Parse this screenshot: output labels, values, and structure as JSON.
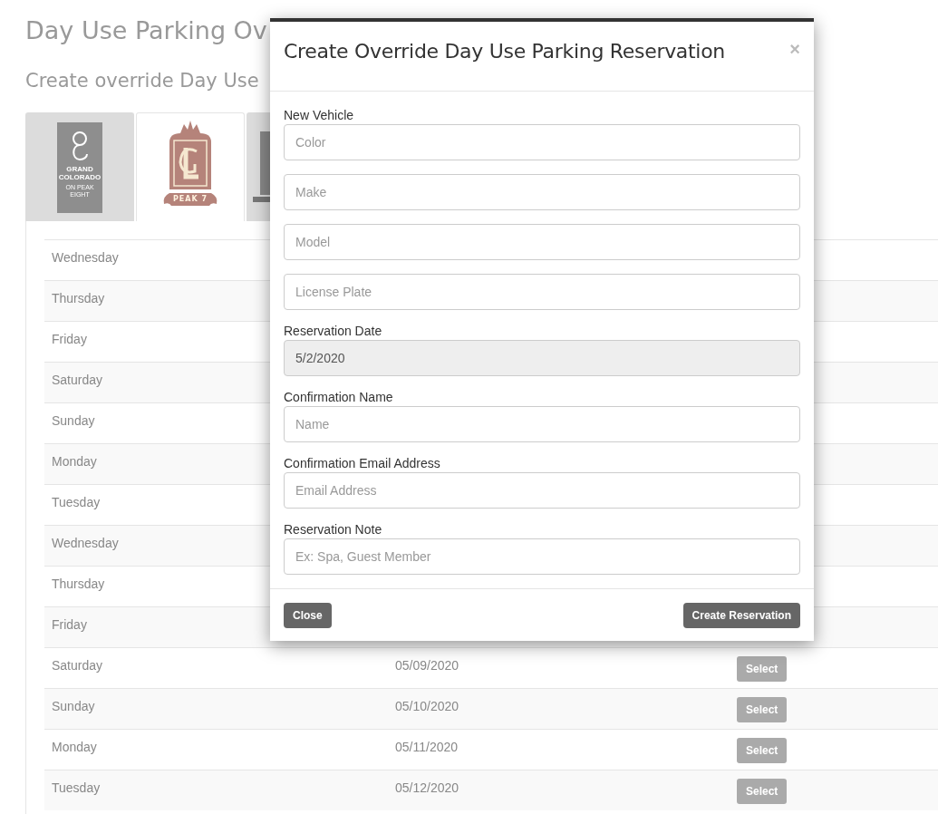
{
  "page": {
    "title": "Day Use Parking Ov",
    "subtitle": "Create override Day Use"
  },
  "property_tabs": [
    {
      "kind": "grand",
      "name": "GRAND COLORADO",
      "tagline": "ON PEAK EIGHT",
      "selected": false
    },
    {
      "kind": "peak",
      "name": "PEAK 7",
      "selected": true
    },
    {
      "kind": "third",
      "selected": false
    }
  ],
  "table": {
    "rows": [
      {
        "day": "Wednesday"
      },
      {
        "day": "Thursday"
      },
      {
        "day": "Friday"
      },
      {
        "day": "Saturday"
      },
      {
        "day": "Sunday"
      },
      {
        "day": "Monday"
      },
      {
        "day": "Tuesday"
      },
      {
        "day": "Wednesday"
      },
      {
        "day": "Thursday"
      },
      {
        "day": "Friday"
      },
      {
        "day": "Saturday",
        "date": "05/09/2020",
        "action": "Select"
      },
      {
        "day": "Sunday",
        "date": "05/10/2020",
        "action": "Select"
      },
      {
        "day": "Monday",
        "date": "05/11/2020",
        "action": "Select"
      },
      {
        "day": "Tuesday",
        "date": "05/12/2020",
        "action": "Select"
      }
    ]
  },
  "modal": {
    "title": "Create Override Day Use Parking Reservation",
    "close_icon": "×",
    "groups": [
      {
        "label": "New Vehicle",
        "inputs": [
          {
            "placeholder": "Color",
            "disabled": false
          },
          {
            "placeholder": "Make",
            "disabled": false
          },
          {
            "placeholder": "Model",
            "disabled": false
          },
          {
            "placeholder": "License Plate",
            "disabled": false
          }
        ]
      },
      {
        "label": "Reservation Date",
        "inputs": [
          {
            "value": "5/2/2020",
            "disabled": true
          }
        ]
      },
      {
        "label": "Confirmation Name",
        "inputs": [
          {
            "placeholder": "Name",
            "disabled": false
          }
        ]
      },
      {
        "label": "Confirmation Email Address",
        "inputs": [
          {
            "placeholder": "Email Address",
            "disabled": false
          }
        ]
      },
      {
        "label": "Reservation Note",
        "inputs": [
          {
            "placeholder": "Ex: Spa, Guest Member",
            "disabled": false
          }
        ]
      }
    ],
    "buttons": [
      "Close",
      "Create Reservation"
    ]
  }
}
